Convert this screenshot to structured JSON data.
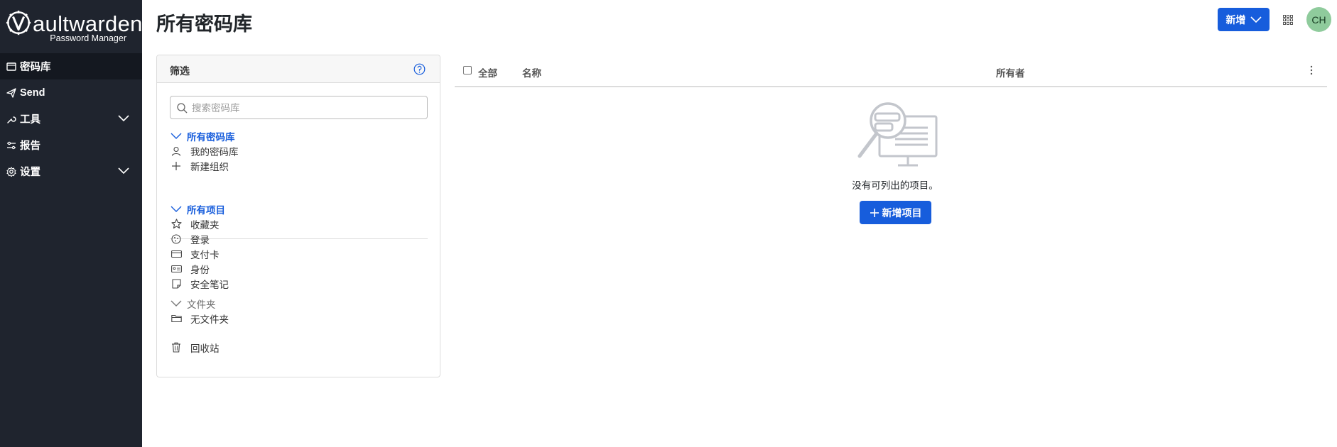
{
  "app": {
    "logo_brand": "aultwarden",
    "logo_subtitle": "Password Manager"
  },
  "sidebar": {
    "items": [
      {
        "label": "密码库",
        "icon": "vault-icon",
        "active": true
      },
      {
        "label": "Send",
        "icon": "send-icon"
      },
      {
        "label": "工具",
        "icon": "wrench-icon",
        "expandable": true
      },
      {
        "label": "报告",
        "icon": "sliders-icon"
      },
      {
        "label": "设置",
        "icon": "gear-icon",
        "expandable": true
      }
    ]
  },
  "header": {
    "title": "所有密码库",
    "new_button": "新增",
    "avatar_initials": "CH"
  },
  "filter": {
    "title": "筛选",
    "search_placeholder": "搜索密码库",
    "vaults": {
      "heading": "所有密码库",
      "items": [
        "我的密码库",
        "新建组织"
      ]
    },
    "types": {
      "heading": "所有项目",
      "items": [
        "收藏夹",
        "登录",
        "支付卡",
        "身份",
        "安全笔记"
      ]
    },
    "folders": {
      "heading": "文件夹",
      "items": [
        "无文件夹"
      ]
    },
    "trash": "回收站"
  },
  "table": {
    "col_all": "全部",
    "col_name": "名称",
    "col_owner": "所有者"
  },
  "empty": {
    "message": "没有可列出的项目。",
    "add_button": "新增项目"
  },
  "colors": {
    "sidebar_bg": "#1f242e",
    "accent": "#175ddc",
    "avatar_bg": "#8fcb9c"
  }
}
